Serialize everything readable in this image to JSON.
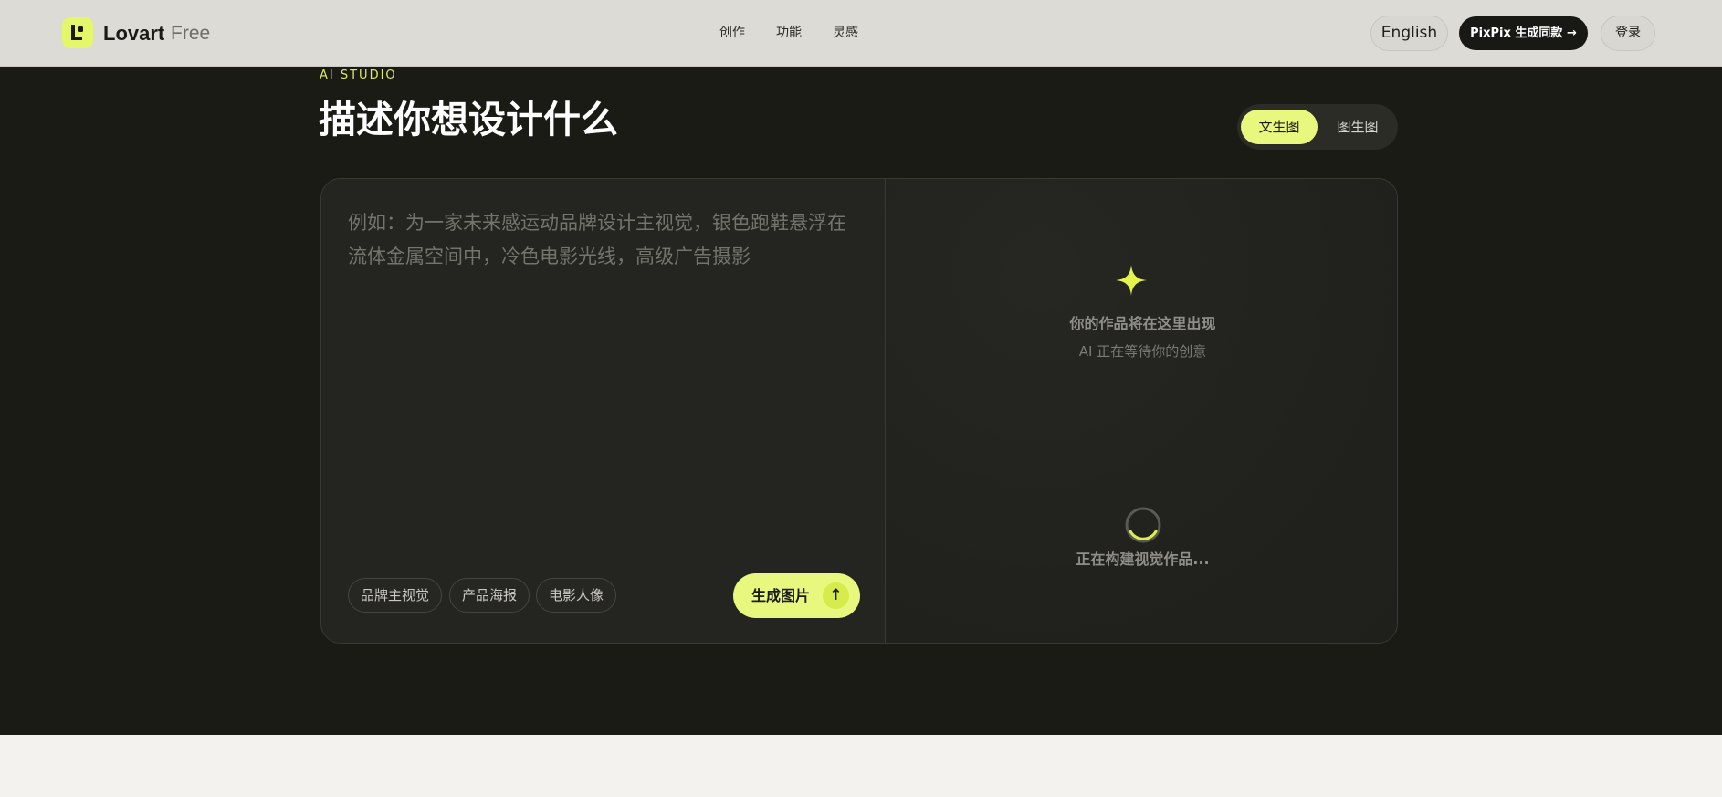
{
  "header": {
    "brand_name": "Lovart",
    "brand_plan": "Free",
    "nav": [
      "创作",
      "功能",
      "灵感"
    ],
    "language_button": "English",
    "cta_button": "PixPix 生成同款 →",
    "login_button": "登录"
  },
  "hero": {
    "eyebrow": "AI STUDIO",
    "title": "描述你想设计什么",
    "modes": [
      "文生图",
      "图生图"
    ],
    "active_mode": "文生图"
  },
  "prompt": {
    "placeholder": "例如：为一家未来感运动品牌设计主视觉，银色跑鞋悬浮在流体金属空间中，冷色电影光线，高级广告摄影",
    "value": ""
  },
  "chips": [
    "品牌主视觉",
    "产品海报",
    "电影人像"
  ],
  "generate_button": "生成图片",
  "generate_icon": "arrow-up-icon",
  "output": {
    "icon": "sparkle-icon",
    "title": "你的作品将在这里出现",
    "subtitle": "AI 正在等待你的创意",
    "status": "正在构建视觉作品..."
  },
  "colors": {
    "accent": "#e8f77e",
    "hero_bg": "#1b1b16",
    "header_bg": "#dcdbd6",
    "page_bg": "#f3f2ee"
  }
}
